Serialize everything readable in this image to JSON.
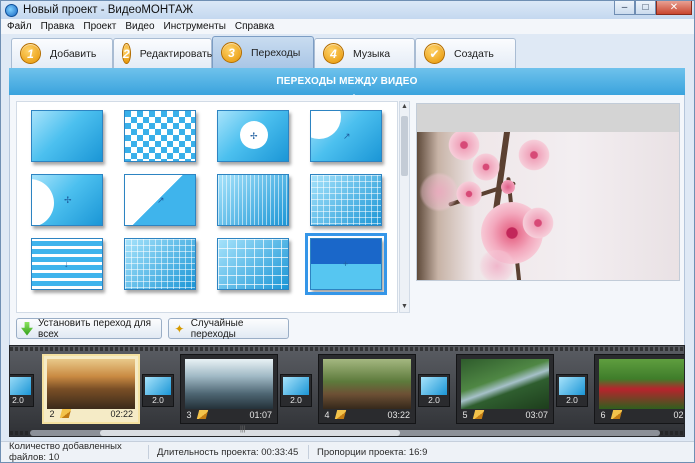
{
  "window": {
    "title": "Новый проект - ВидеоМОНТАЖ",
    "minimize": "–",
    "maximize": "□",
    "close": "✕"
  },
  "menu": [
    "Файл",
    "Правка",
    "Проект",
    "Видео",
    "Инструменты",
    "Справка"
  ],
  "tabs": [
    {
      "num": "1",
      "label": "Добавить",
      "active": false
    },
    {
      "num": "2",
      "label": "Редактировать",
      "active": false
    },
    {
      "num": "3",
      "label": "Переходы",
      "active": true
    },
    {
      "num": "4",
      "label": "Музыка",
      "active": false
    },
    {
      "num": "✔",
      "label": "Создать",
      "active": false
    }
  ],
  "section_title": "ПЕРЕХОДЫ МЕЖДУ ВИДЕО",
  "transitions": {
    "selected_index": 11,
    "items": [
      {
        "style": "fade",
        "mark": ""
      },
      {
        "style": "checker",
        "mark": ""
      },
      {
        "style": "circle-center",
        "mark": "✢"
      },
      {
        "style": "circle-tl",
        "mark": "↗"
      },
      {
        "style": "circle-left",
        "mark": "✢"
      },
      {
        "style": "diag",
        "mark": "↗"
      },
      {
        "style": "stripes-fine",
        "mark": ""
      },
      {
        "style": "grid",
        "mark": ""
      },
      {
        "style": "stripes",
        "mark": "↓"
      },
      {
        "style": "grid",
        "mark": ""
      },
      {
        "style": "grid-big",
        "mark": ""
      },
      {
        "style": "split",
        "mark": "+"
      }
    ]
  },
  "scroll_icons": {
    "up": "▲",
    "down": "▼"
  },
  "buttons": {
    "install_all": "Установить переход для всех",
    "random": "Случайные переходы"
  },
  "timeline": {
    "arrow_left": "❮",
    "arrow_right": "❯",
    "slots": [
      {
        "num": "2",
        "duration": "02:22",
        "active": true,
        "scene": "canyon"
      },
      {
        "num": "3",
        "duration": "01:07",
        "active": false,
        "scene": "forest"
      },
      {
        "num": "4",
        "duration": "03:22",
        "active": false,
        "scene": "bridge"
      },
      {
        "num": "5",
        "duration": "03:07",
        "active": false,
        "scene": "river"
      },
      {
        "num": "6",
        "duration": "02:",
        "active": false,
        "scene": "flowers"
      }
    ],
    "transitions": [
      "2.0",
      "2.0",
      "2.0",
      "2.0",
      "2.0"
    ],
    "scroll_grip": "|||"
  },
  "status": {
    "files": "Количество добавленных файлов: 10",
    "duration": "Длительность проекта: 00:33:45",
    "ratio": "Пропорции проекта: 16:9"
  },
  "colors": {
    "accent": "#3aa3dd",
    "tab_badge": "#e59300",
    "selection": "#3596e8"
  }
}
